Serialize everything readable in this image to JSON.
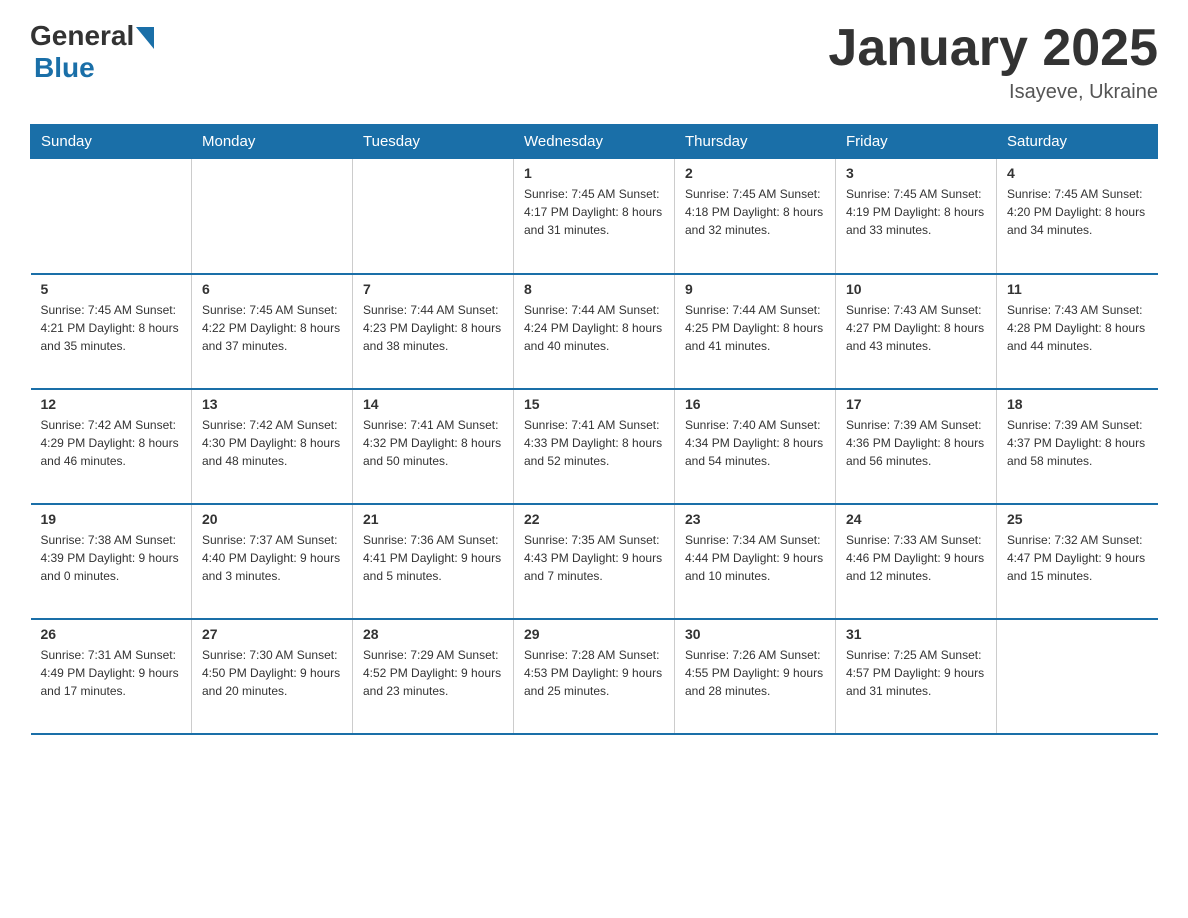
{
  "logo": {
    "general": "General",
    "blue": "Blue"
  },
  "title": "January 2025",
  "subtitle": "Isayeve, Ukraine",
  "days_of_week": [
    "Sunday",
    "Monday",
    "Tuesday",
    "Wednesday",
    "Thursday",
    "Friday",
    "Saturday"
  ],
  "weeks": [
    [
      {
        "num": "",
        "info": ""
      },
      {
        "num": "",
        "info": ""
      },
      {
        "num": "",
        "info": ""
      },
      {
        "num": "1",
        "info": "Sunrise: 7:45 AM\nSunset: 4:17 PM\nDaylight: 8 hours and 31 minutes."
      },
      {
        "num": "2",
        "info": "Sunrise: 7:45 AM\nSunset: 4:18 PM\nDaylight: 8 hours and 32 minutes."
      },
      {
        "num": "3",
        "info": "Sunrise: 7:45 AM\nSunset: 4:19 PM\nDaylight: 8 hours and 33 minutes."
      },
      {
        "num": "4",
        "info": "Sunrise: 7:45 AM\nSunset: 4:20 PM\nDaylight: 8 hours and 34 minutes."
      }
    ],
    [
      {
        "num": "5",
        "info": "Sunrise: 7:45 AM\nSunset: 4:21 PM\nDaylight: 8 hours and 35 minutes."
      },
      {
        "num": "6",
        "info": "Sunrise: 7:45 AM\nSunset: 4:22 PM\nDaylight: 8 hours and 37 minutes."
      },
      {
        "num": "7",
        "info": "Sunrise: 7:44 AM\nSunset: 4:23 PM\nDaylight: 8 hours and 38 minutes."
      },
      {
        "num": "8",
        "info": "Sunrise: 7:44 AM\nSunset: 4:24 PM\nDaylight: 8 hours and 40 minutes."
      },
      {
        "num": "9",
        "info": "Sunrise: 7:44 AM\nSunset: 4:25 PM\nDaylight: 8 hours and 41 minutes."
      },
      {
        "num": "10",
        "info": "Sunrise: 7:43 AM\nSunset: 4:27 PM\nDaylight: 8 hours and 43 minutes."
      },
      {
        "num": "11",
        "info": "Sunrise: 7:43 AM\nSunset: 4:28 PM\nDaylight: 8 hours and 44 minutes."
      }
    ],
    [
      {
        "num": "12",
        "info": "Sunrise: 7:42 AM\nSunset: 4:29 PM\nDaylight: 8 hours and 46 minutes."
      },
      {
        "num": "13",
        "info": "Sunrise: 7:42 AM\nSunset: 4:30 PM\nDaylight: 8 hours and 48 minutes."
      },
      {
        "num": "14",
        "info": "Sunrise: 7:41 AM\nSunset: 4:32 PM\nDaylight: 8 hours and 50 minutes."
      },
      {
        "num": "15",
        "info": "Sunrise: 7:41 AM\nSunset: 4:33 PM\nDaylight: 8 hours and 52 minutes."
      },
      {
        "num": "16",
        "info": "Sunrise: 7:40 AM\nSunset: 4:34 PM\nDaylight: 8 hours and 54 minutes."
      },
      {
        "num": "17",
        "info": "Sunrise: 7:39 AM\nSunset: 4:36 PM\nDaylight: 8 hours and 56 minutes."
      },
      {
        "num": "18",
        "info": "Sunrise: 7:39 AM\nSunset: 4:37 PM\nDaylight: 8 hours and 58 minutes."
      }
    ],
    [
      {
        "num": "19",
        "info": "Sunrise: 7:38 AM\nSunset: 4:39 PM\nDaylight: 9 hours and 0 minutes."
      },
      {
        "num": "20",
        "info": "Sunrise: 7:37 AM\nSunset: 4:40 PM\nDaylight: 9 hours and 3 minutes."
      },
      {
        "num": "21",
        "info": "Sunrise: 7:36 AM\nSunset: 4:41 PM\nDaylight: 9 hours and 5 minutes."
      },
      {
        "num": "22",
        "info": "Sunrise: 7:35 AM\nSunset: 4:43 PM\nDaylight: 9 hours and 7 minutes."
      },
      {
        "num": "23",
        "info": "Sunrise: 7:34 AM\nSunset: 4:44 PM\nDaylight: 9 hours and 10 minutes."
      },
      {
        "num": "24",
        "info": "Sunrise: 7:33 AM\nSunset: 4:46 PM\nDaylight: 9 hours and 12 minutes."
      },
      {
        "num": "25",
        "info": "Sunrise: 7:32 AM\nSunset: 4:47 PM\nDaylight: 9 hours and 15 minutes."
      }
    ],
    [
      {
        "num": "26",
        "info": "Sunrise: 7:31 AM\nSunset: 4:49 PM\nDaylight: 9 hours and 17 minutes."
      },
      {
        "num": "27",
        "info": "Sunrise: 7:30 AM\nSunset: 4:50 PM\nDaylight: 9 hours and 20 minutes."
      },
      {
        "num": "28",
        "info": "Sunrise: 7:29 AM\nSunset: 4:52 PM\nDaylight: 9 hours and 23 minutes."
      },
      {
        "num": "29",
        "info": "Sunrise: 7:28 AM\nSunset: 4:53 PM\nDaylight: 9 hours and 25 minutes."
      },
      {
        "num": "30",
        "info": "Sunrise: 7:26 AM\nSunset: 4:55 PM\nDaylight: 9 hours and 28 minutes."
      },
      {
        "num": "31",
        "info": "Sunrise: 7:25 AM\nSunset: 4:57 PM\nDaylight: 9 hours and 31 minutes."
      },
      {
        "num": "",
        "info": ""
      }
    ]
  ]
}
